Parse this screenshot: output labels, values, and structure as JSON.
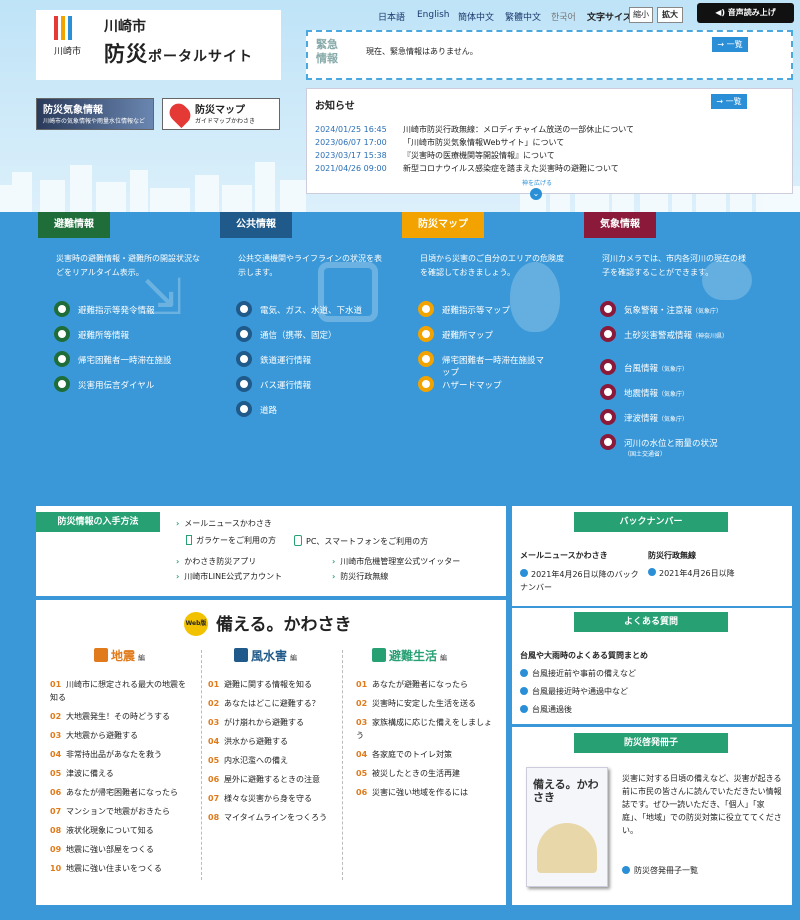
{
  "header": {
    "logo_city": "川崎市",
    "logo_title": "防災",
    "logo_title_rest": "ポータルサイト",
    "logo_city_small": "川崎市",
    "languages": [
      "日本語",
      "English",
      "簡体中文",
      "繁體中文",
      "한국어"
    ],
    "font_size_label": "文字サイズ",
    "shrink": "縮小",
    "enlarge": "拡大",
    "voice": "音声読み上げ"
  },
  "emergency": {
    "label": "緊急情報",
    "message": "現在、緊急情報はありません。",
    "list_button": "一覧"
  },
  "news": {
    "title": "お知らせ",
    "list_button": "一覧",
    "items": [
      {
        "date": "2024/01/25 16:45",
        "text": "川崎市防災行政無線：メロディチャイム放送の一部休止について"
      },
      {
        "date": "2023/06/07 17:00",
        "text": "「川崎市防災気象情報Webサイト」について"
      },
      {
        "date": "2023/03/17 15:38",
        "text": "『災害時の医療機関等開設情報』について"
      },
      {
        "date": "2021/04/26 09:00",
        "text": "新型コロナウイルス感染症を踏まえた災害時の避難について"
      }
    ],
    "more": "神を広げる"
  },
  "banners": {
    "weather_title": "防災気象情報",
    "weather_sub": "川崎市の気象情報や雨量水位情報など",
    "map_title": "防災マップ",
    "map_sub": "ガイドマップかわさき"
  },
  "categories": [
    {
      "title": "避難情報",
      "color": "#1f6e3a",
      "desc": "災害時の避難情報・避難所の開設状況などをリアルタイム表示。",
      "items": [
        "避難指示等発令情報",
        "避難所等情報",
        "帰宅困難者一時滞在施設",
        "災害用伝言ダイヤル"
      ]
    },
    {
      "title": "公共情報",
      "color": "#1f5a8a",
      "desc": "公共交通機関やライフラインの状況を表示します。",
      "items": [
        "電気、ガス、水道、下水道",
        "通信（携帯、固定）",
        "鉄道運行情報",
        "バス運行情報",
        "道路"
      ]
    },
    {
      "title": "防災マップ",
      "color": "#f2a300",
      "desc": "日頃から災害のご自分のエリアの危険度を確認しておきましょう。",
      "items": [
        "避難指示等マップ",
        "避難所マップ",
        "帰宅困難者一時滞在施設マップ",
        "ハザードマップ"
      ]
    },
    {
      "title": "気象情報",
      "color": "#8b1a3a",
      "desc": "河川カメラでは、市内各河川の現在の様子を確認することができます。",
      "items": [
        "気象警報・注意報",
        "土砂災害警戒情報",
        "台風情報",
        "地震情報",
        "津波情報",
        "河川の水位と雨量の状況"
      ],
      "notes": [
        "（気象庁）",
        "（神奈川県）",
        "（気象庁）",
        "（気象庁）",
        "（気象庁）",
        "（国土交通省）"
      ]
    }
  ],
  "howto": {
    "title": "防災情報の入手方法",
    "mail_news": "メールニュースかわさき",
    "galake": "ガラケーをご利用の方",
    "pc": "PC、スマートフォンをご利用の方",
    "app": "かわさき防災アプリ",
    "twitter": "川崎市危機管理室公式ツイッター",
    "line": "川崎市LINE公式アカウント",
    "radio": "防災行政無線"
  },
  "backnumber": {
    "title": "バックナンバー",
    "col1_head": "メールニュースかわさき",
    "col1_link": "2021年4月26日以降のバックナンバー",
    "col2_head": "防災行政無線",
    "col2_link": "2021年4月26日以降"
  },
  "faq": {
    "title": "よくある質問",
    "head": "台風や大雨時のよくある質問まとめ",
    "items": [
      "台風接近前や事前の備えなど",
      "台風最接近時や通過中など",
      "台風通過後"
    ]
  },
  "booklet": {
    "title": "防災啓発冊子",
    "text": "災害に対する日頃の備えなど、災害が起きる前に市民の皆さんに読んでいただきたい情報誌です。ぜひ一読いただき、「個人」「家庭」、「地域」での防災対策に役立ててください。",
    "link": "防災啓発冊子一覧",
    "cover": "備える。かわさき"
  },
  "sonaeru": {
    "badge": "Web版",
    "title": "備える。かわさき",
    "earthquake": {
      "title": "地震",
      "suffix": "編",
      "items": [
        "川崎市に想定される最大の地震を知る",
        "大地震発生！その時どうする",
        "大地震から避難する",
        "非常持出品があなたを救う",
        "津波に備える",
        "あなたが帰宅困難者になったら",
        "マンションで地震がおきたら",
        "液状化現象について知る",
        "地震に強い部屋をつくる",
        "地震に強い住まいをつくる"
      ]
    },
    "flood": {
      "title": "風水害",
      "suffix": "編",
      "items": [
        "避難に関する情報を知る",
        "あなたはどこに避難する？",
        "がけ崩れから避難する",
        "洪水から避難する",
        "内水氾濫への備え",
        "屋外に避難するときの注意",
        "様々な災害から身を守る",
        "マイタイムラインをつくろう"
      ]
    },
    "life": {
      "title": "避難生活",
      "suffix": "編",
      "items": [
        "あなたが避難者になったら",
        "災害時に安定した生活を送る",
        "家族構成に応じた備えをしましょう",
        "各家庭でのトイレ対策",
        "被災したときの生活再建",
        "災害に強い地域を作るには"
      ]
    }
  }
}
